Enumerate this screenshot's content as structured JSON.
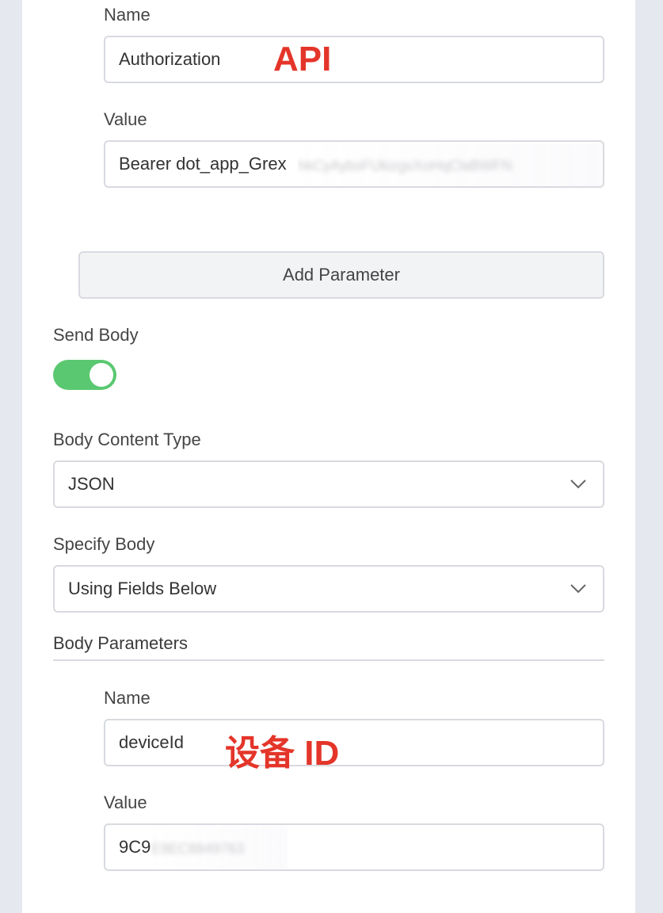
{
  "header_params": {
    "name_label": "Name",
    "name_value": "Authorization",
    "name_annotation": "API",
    "value_label": "Value",
    "value_visible": "Bearer dot_app_Grex",
    "value_obscured": "hkCyAybxFUkizgvXoHqClaBWFN",
    "add_button_label": "Add Parameter"
  },
  "send_body": {
    "label": "Send Body",
    "enabled": true,
    "toggle_color": "#5ac870"
  },
  "body_content_type": {
    "label": "Body Content Type",
    "selected": "JSON"
  },
  "specify_body": {
    "label": "Specify Body",
    "selected": "Using Fields Below"
  },
  "body_params": {
    "section_title": "Body Parameters",
    "name_label": "Name",
    "name_value": "deviceId",
    "name_annotation": "设备 ID",
    "value_label": "Value",
    "value_visible": "9C9",
    "value_obscured": "E9EC8849763"
  },
  "colors": {
    "annotation": "#e4352a",
    "background": "#e6e8f0"
  }
}
